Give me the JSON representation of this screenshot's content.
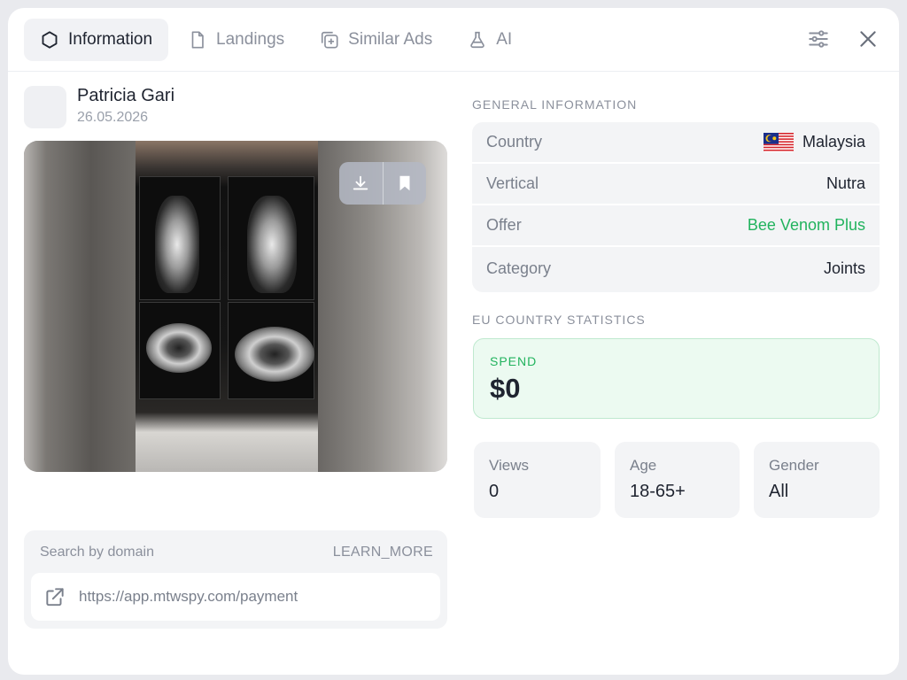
{
  "tabs": [
    {
      "label": "Information",
      "icon": "hexagon-icon",
      "active": true
    },
    {
      "label": "Landings",
      "icon": "file-icon",
      "active": false
    },
    {
      "label": "Similar Ads",
      "icon": "copy-plus-icon",
      "active": false
    },
    {
      "label": "AI",
      "icon": "flask-icon",
      "active": false
    }
  ],
  "header_actions": {
    "settings_icon": "sliders-icon",
    "close_icon": "close-icon"
  },
  "author": {
    "name": "Patricia Gari",
    "date": "26.05.2026"
  },
  "media": {
    "download_icon": "download-icon",
    "bookmark_icon": "bookmark-icon"
  },
  "domain_search": {
    "title": "Search by domain",
    "learn_more": "LEARN_MORE",
    "url": "https://app.mtwspy.com/payment",
    "icon": "external-link-icon"
  },
  "general_information": {
    "title": "GENERAL INFORMATION",
    "rows": [
      {
        "label": "Country",
        "value": "Malaysia",
        "flag": "malaysia-flag"
      },
      {
        "label": "Vertical",
        "value": "Nutra"
      },
      {
        "label": "Offer",
        "value": "Bee Venom Plus",
        "accent": "#22b35e"
      },
      {
        "label": "Category",
        "value": "Joints"
      }
    ]
  },
  "eu_statistics": {
    "title": "EU COUNTRY STATISTICS",
    "spend_label": "SPEND",
    "spend_value": "$0",
    "stats": [
      {
        "label": "Views",
        "value": "0"
      },
      {
        "label": "Age",
        "value": "18-65+"
      },
      {
        "label": "Gender",
        "value": "All"
      }
    ]
  },
  "colors": {
    "accent_green": "#22b35e",
    "muted_text": "#8b909c",
    "panel_bg": "#f3f4f6"
  }
}
